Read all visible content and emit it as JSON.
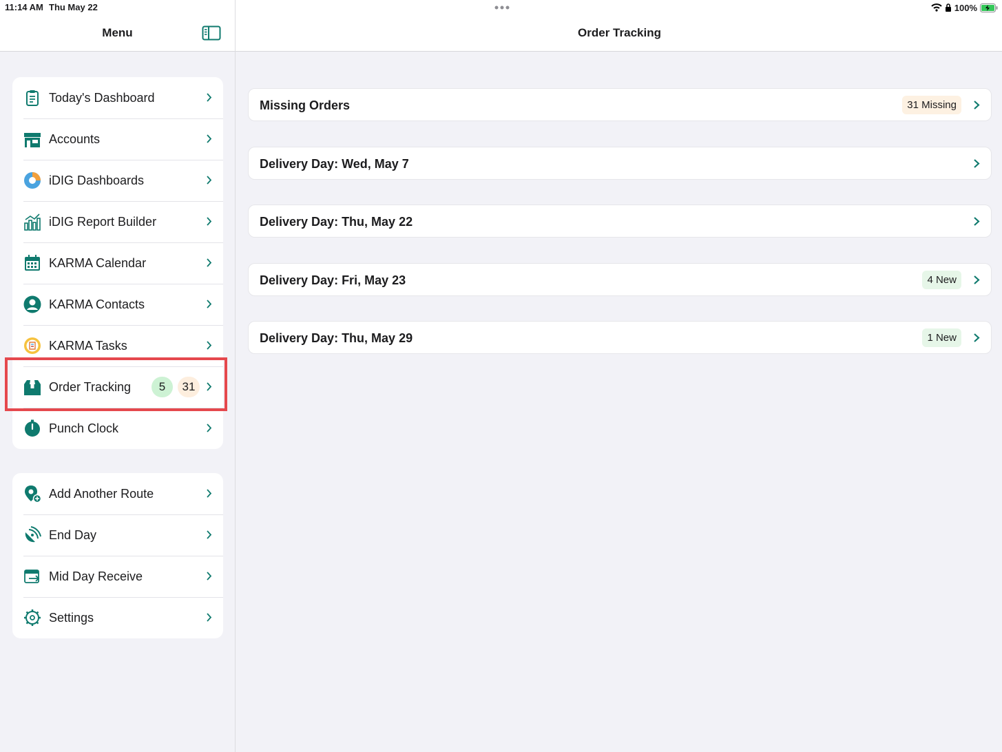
{
  "status": {
    "time": "11:14 AM",
    "date": "Thu May 22",
    "battery": "100%"
  },
  "sidebar": {
    "title": "Menu",
    "groups": [
      {
        "items": [
          {
            "label": "Today's Dashboard",
            "icon": "clipboard-icon"
          },
          {
            "label": "Accounts",
            "icon": "store-icon"
          },
          {
            "label": "iDIG Dashboards",
            "icon": "pie-chart-icon"
          },
          {
            "label": "iDIG Report Builder",
            "icon": "bar-chart-icon"
          },
          {
            "label": "KARMA Calendar",
            "icon": "calendar-icon"
          },
          {
            "label": "KARMA Contacts",
            "icon": "person-circle-icon"
          },
          {
            "label": "KARMA Tasks",
            "icon": "tasks-icon"
          },
          {
            "label": "Order Tracking",
            "icon": "box-icon",
            "badge_green": "5",
            "badge_orange": "31"
          },
          {
            "label": "Punch Clock",
            "icon": "stopwatch-icon"
          }
        ]
      },
      {
        "items": [
          {
            "label": "Add Another Route",
            "icon": "add-location-icon"
          },
          {
            "label": "End Day",
            "icon": "satellite-icon"
          },
          {
            "label": "Mid Day Receive",
            "icon": "calendar-arrow-icon"
          },
          {
            "label": "Settings",
            "icon": "gear-icon"
          }
        ]
      }
    ]
  },
  "main": {
    "title": "Order Tracking",
    "cards": [
      {
        "title": "Missing Orders",
        "pill": "31 Missing",
        "pill_color": "orange"
      },
      {
        "title": "Delivery Day: Wed, May 7",
        "pill": ""
      },
      {
        "title": "Delivery Day: Thu, May 22",
        "pill": ""
      },
      {
        "title": "Delivery Day: Fri, May 23",
        "pill": "4 New",
        "pill_color": "green"
      },
      {
        "title": "Delivery Day: Thu, May 29",
        "pill": "1 New",
        "pill_color": "green"
      }
    ]
  },
  "colors": {
    "accent": "#0f7a6e",
    "highlight": "#e5484d",
    "badge_green": "#cdf2d4",
    "badge_orange": "#fdeede"
  }
}
